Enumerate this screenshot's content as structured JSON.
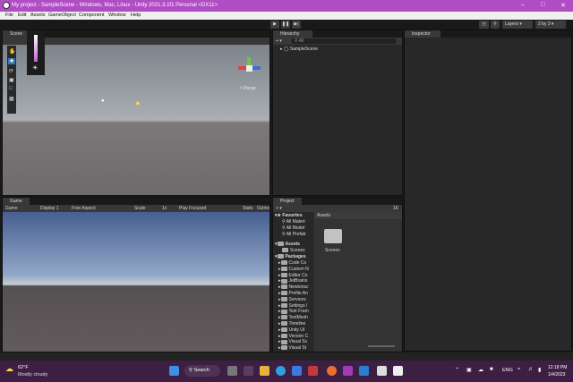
{
  "window": {
    "title": "My project - SampleScene - Windows, Mac, Linux - Unity 2021.3.1f1 Personal <DX11>"
  },
  "menu": [
    "File",
    "Edit",
    "Assets",
    "GameObject",
    "Component",
    "Window",
    "Help"
  ],
  "toolbar": {
    "layers": "Layers",
    "layout": "2 by 3"
  },
  "scene": {
    "tab": "Scene",
    "persp": "< Persp"
  },
  "game": {
    "tab": "Game",
    "game_label": "Game",
    "display": "Display 1",
    "aspect": "Free Aspect",
    "scale_label": "Scale",
    "scale_value": "1x",
    "play_focused": "Play Focused",
    "stats": "Stats",
    "gizmos": "Gizmos"
  },
  "hierarchy": {
    "tab": "Hierarchy",
    "search": "All",
    "scene_item": "SampleScene"
  },
  "inspector": {
    "tab": "Inspector"
  },
  "project": {
    "tab": "Project",
    "count": "16",
    "favorites": "Favorites",
    "fav_items": [
      "All Materi",
      "All Model",
      "All Prefab"
    ],
    "assets": "Assets",
    "asset_items": [
      "Scenes"
    ],
    "packages": "Packages",
    "package_items": [
      "Code Co",
      "Custom N",
      "Editor Co",
      "JetBrains",
      "Newtonsc",
      "Profile An",
      "Services",
      "Settings I",
      "Test Fram",
      "TextMesh",
      "Timeline",
      "Unity UI",
      "Version C",
      "Visual Sc",
      "Visual St"
    ],
    "breadcrumb": "Assets",
    "grid_item": "Scenes"
  },
  "taskbar": {
    "temp": "62°F",
    "weather": "Mostly cloudy",
    "search": "Search",
    "lang": "ENG",
    "time": "12:18 PM",
    "date": "1/4/2023"
  }
}
